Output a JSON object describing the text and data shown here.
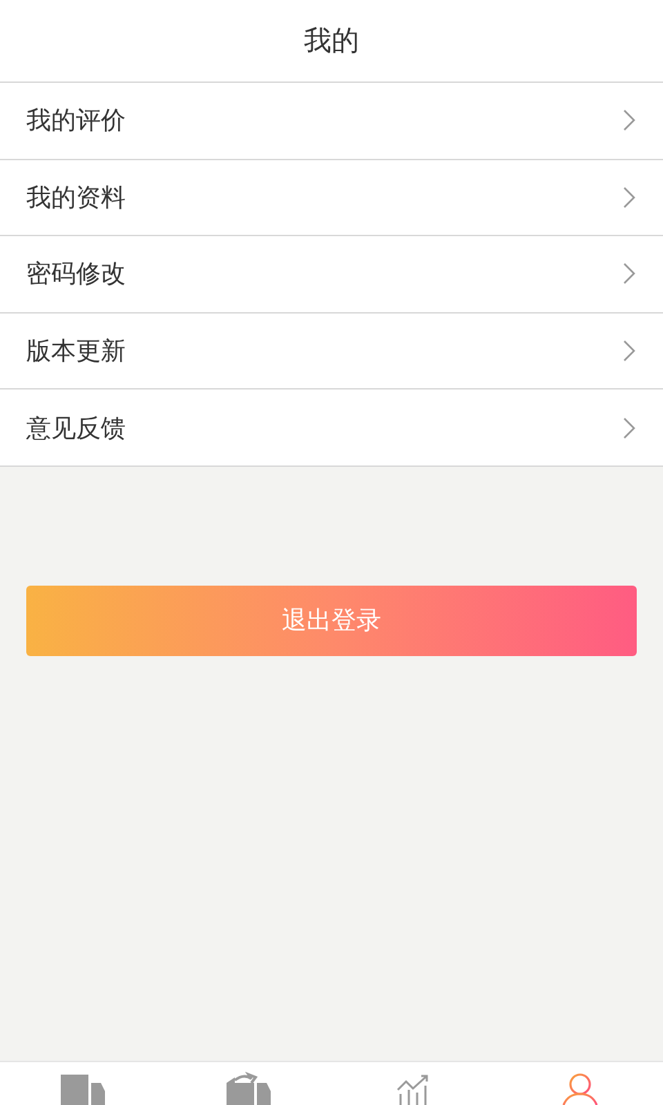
{
  "header": {
    "title": "我的"
  },
  "menu": [
    {
      "label": "我的评价"
    },
    {
      "label": "我的资料"
    },
    {
      "label": "密码修改"
    },
    {
      "label": "版本更新"
    },
    {
      "label": "意见反馈"
    }
  ],
  "logout_button": {
    "label": "退出登录"
  },
  "tab_bar": [
    {
      "kind": "truck",
      "selected": false
    },
    {
      "kind": "dispatch",
      "selected": false
    },
    {
      "kind": "chart",
      "selected": false
    },
    {
      "kind": "person",
      "selected": true
    }
  ]
}
